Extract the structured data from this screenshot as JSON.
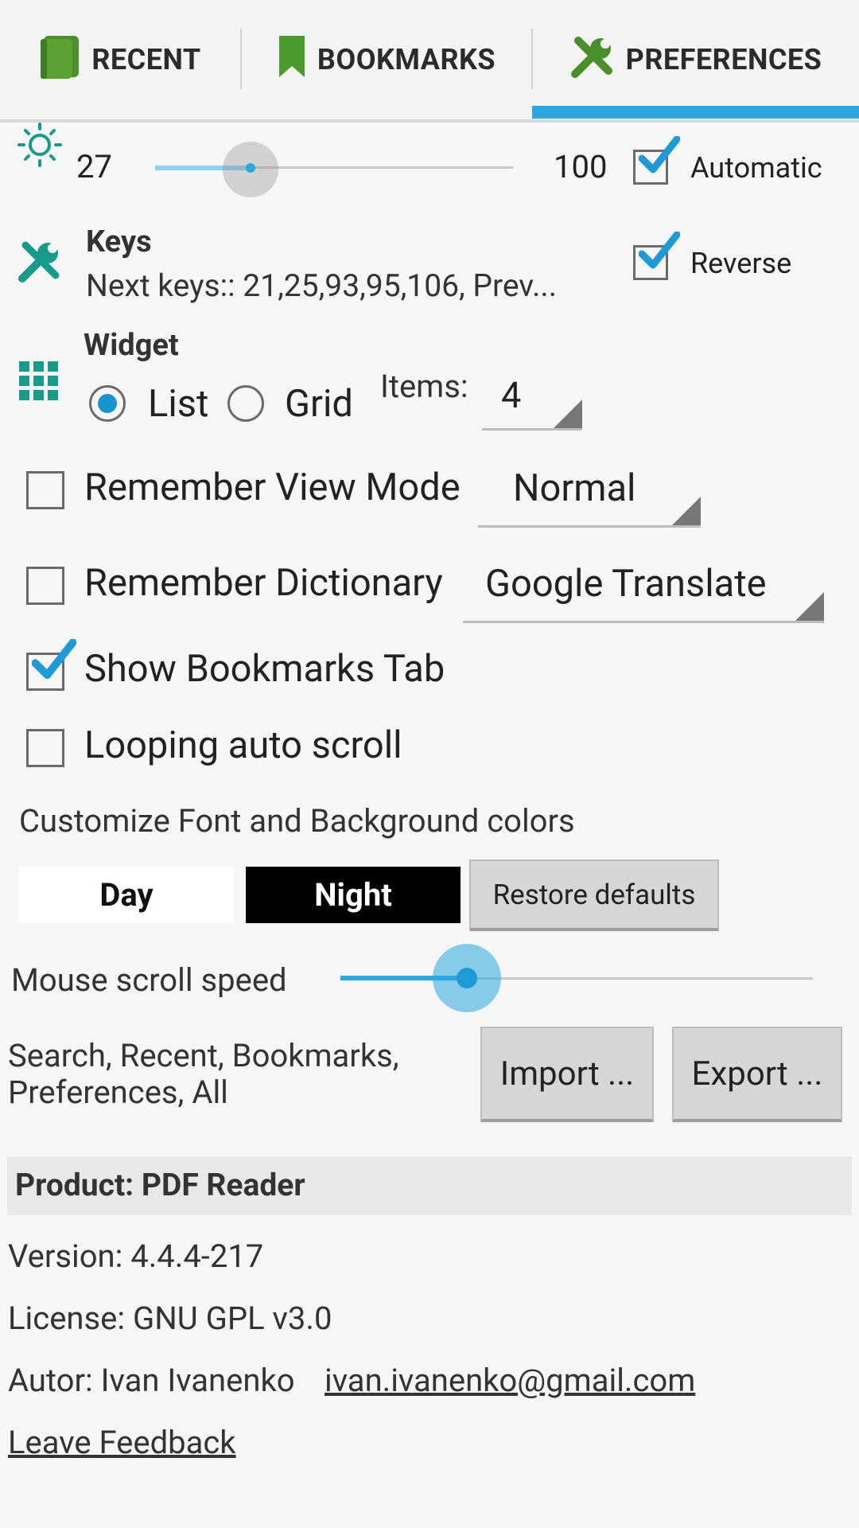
{
  "tabs": [
    {
      "label": "RECENT",
      "icon": "book-icon"
    },
    {
      "label": "BOOKMARKS",
      "icon": "bookmark-icon"
    },
    {
      "label": "PREFERENCES",
      "icon": "tools-icon"
    }
  ],
  "colors": {
    "accent": "#2aa7e0",
    "green": "#4a8f2b",
    "teal": "#1a9a8a"
  },
  "brightness": {
    "min_label": "27",
    "max_label": "100",
    "automatic_label": "Automatic",
    "automatic_checked": true,
    "icon": "brightness-icon"
  },
  "keys": {
    "title": "Keys",
    "summary": "Next keys:: 21,25,93,95,106,  Prev...",
    "reverse_label": "Reverse",
    "reverse_checked": true,
    "icon": "wrench-icon"
  },
  "widget": {
    "title": "Widget",
    "list_label": "List",
    "grid_label": "Grid",
    "selected": "List",
    "items_label": "Items:",
    "items_value": "4",
    "icon": "grid-icon"
  },
  "view_mode": {
    "label": "Remember View Mode",
    "checked": false,
    "value": "Normal"
  },
  "dictionary": {
    "label": "Remember Dictionary",
    "checked": false,
    "value": "Google Translate"
  },
  "bookmarks_tab": {
    "label": "Show Bookmarks Tab",
    "checked": true
  },
  "looping": {
    "label": "Looping auto scroll",
    "checked": false
  },
  "colors_section": {
    "label": "Customize Font and Background colors",
    "day": "Day",
    "night": "Night",
    "restore": "Restore defaults"
  },
  "mouse_scroll": {
    "label": "Mouse scroll speed"
  },
  "import_export": {
    "label": "Search, Recent, Bookmarks, Preferences, All",
    "import": "Import ...",
    "export": "Export ..."
  },
  "about": {
    "product": "Product: PDF Reader",
    "version": "Version: 4.4.4-217",
    "license": "License: GNU GPL v3.0",
    "author_label": "Autor: Ivan Ivanenko",
    "author_email": "ivan.ivanenko@gmail.com",
    "feedback": "Leave Feedback"
  }
}
